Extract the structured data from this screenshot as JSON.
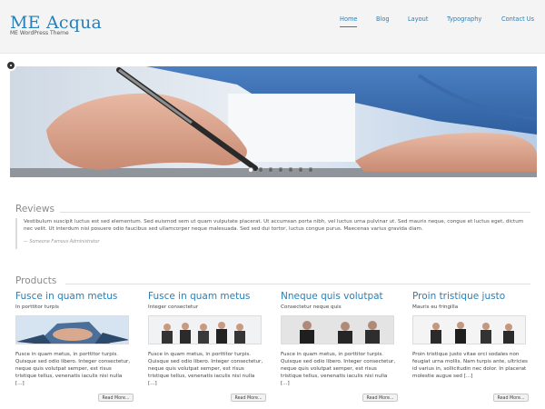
{
  "header": {
    "logo": "ME Acqua",
    "tagline": "ME WordPress Theme",
    "nav": [
      "Home",
      "Blog",
      "Layout",
      "Typography",
      "Contact Us"
    ],
    "active_nav": "Home"
  },
  "slider": {
    "slide_count": 7,
    "active_slide": 1
  },
  "reviews": {
    "title": "Reviews",
    "text": "Vestibulum suscipit luctus est sed elementum. Sed euismod sem ut quam vulputate placerat. Ut accumsan porta nibh, vel luctus urna pulvinar ut. Sed mauris neque, congue et luctus eget, dictum nec velit. Ut interdum nisl posuere odio faucibus sed ullamcorper neque malesuada. Sed sed dui tortor, luctus congue purus. Maecenas varius gravida diam.",
    "author": "— Someone Famous Administrator"
  },
  "products": {
    "title": "Products",
    "items": [
      {
        "title": "Fusce in quam metus",
        "subtitle": "In porttitor turpis",
        "description": "Fusce in quam metus, in porttitor turpis. Quisque sed odio libero. Integer consectetur, neque quis volutpat semper, est risus tristique tellus, venenatis iaculis nisi nulla [...]",
        "button": "Read More..."
      },
      {
        "title": "Fusce in quam metus",
        "subtitle": "Integer consectetur",
        "description": "Fusce in quam metus, in porttitor turpis. Quisque sed odio libero. Integer consectetur, neque quis volutpat semper, est risus tristique tellus, venenatis iaculis nisi nulla [...]",
        "button": "Read More..."
      },
      {
        "title": "Nneque quis volutpat",
        "subtitle": "Consectetur neque quis",
        "description": "Fusce in quam metus, in porttitor turpis. Quisque sed odio libero. Integer consectetur, neque quis volutpat semper, est risus tristique tellus, venenatis iaculis nisi nulla [...]",
        "button": "Read More..."
      },
      {
        "title": "Proin tristique justo",
        "subtitle": "Mauris eu fringilla",
        "description": "Proin tristique justo vitae orci sodales non feugiat urna mollis. Nam turpis ante, ultricies id varius in, sollicitudin nec dolor. In placerat molestie augue sed [...]",
        "button": "Read More..."
      }
    ]
  },
  "colors": {
    "accent": "#2a7fb5",
    "heading_gray": "#8a8a8a",
    "header_bg": "#f4f4f4"
  }
}
